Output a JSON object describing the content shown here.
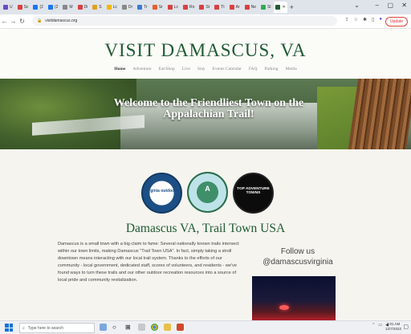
{
  "browser": {
    "tabs": [
      {
        "label": "U",
        "color": "#6b4ac4"
      },
      {
        "label": "Sc",
        "color": "#d94040"
      },
      {
        "label": "(2",
        "color": "#1877f2"
      },
      {
        "label": "(2",
        "color": "#1877f2"
      },
      {
        "label": "M",
        "color": "#888888"
      },
      {
        "label": "Di",
        "color": "#d94040"
      },
      {
        "label": "S",
        "color": "#e0a020"
      },
      {
        "label": "Lc",
        "color": "#f2b600"
      },
      {
        "label": "Dr",
        "color": "#888888"
      },
      {
        "label": "Tr",
        "color": "#3a7bd5"
      },
      {
        "label": "Sr",
        "color": "#e06030"
      },
      {
        "label": "Lc",
        "color": "#d94040"
      },
      {
        "label": "Ro",
        "color": "#d94040"
      },
      {
        "label": "St",
        "color": "#d94040"
      },
      {
        "label": "Tt",
        "color": "#d94040"
      },
      {
        "label": "Ar",
        "color": "#d94040"
      },
      {
        "label": "Ne",
        "color": "#d94040"
      },
      {
        "label": "Sl",
        "color": "#34a853"
      },
      {
        "label": "✕",
        "color": "#1e5b32",
        "active": true
      }
    ],
    "url": "visitdamascus.org",
    "update_label": "Update"
  },
  "site": {
    "title": "VISIT DAMASCUS, VA",
    "nav": [
      "Home",
      "Adventure",
      "Eat/Shop",
      "Live",
      "Stay",
      "Events Calendar",
      "FAQ",
      "Parking",
      "Media"
    ],
    "hero_title": "Welcome to the Friendliest Town on the Appalachian Trail!",
    "badges": [
      {
        "text": "virginia outdoors"
      },
      {
        "text": "A"
      },
      {
        "text": "TOP ADVENTURE TOWNS"
      }
    ],
    "section_title": "Damascus VA, Trail Town USA",
    "body": "Damascus is a small town with a big claim to fame: Several nationally known trails intersect within our town limits, making Damascus \"Trail Town USA\". In fact, simply taking a stroll downtown means interacting with our local trail system. Thanks to the efforts of our community - local government, dedicated staff, scores of volunteers, and residents - we've found ways to turn these trails and our other outdoor recreation resources into a source of local pride and community revitalization.",
    "follow_line1": "Follow us",
    "follow_line2": "@damascusvirginia"
  },
  "taskbar": {
    "search_placeholder": "Type here to search",
    "time": "2:01 AM",
    "date": "12/7/2022"
  },
  "colors": {
    "brand_green": "#1e5b32",
    "update_red": "#e0443a"
  }
}
